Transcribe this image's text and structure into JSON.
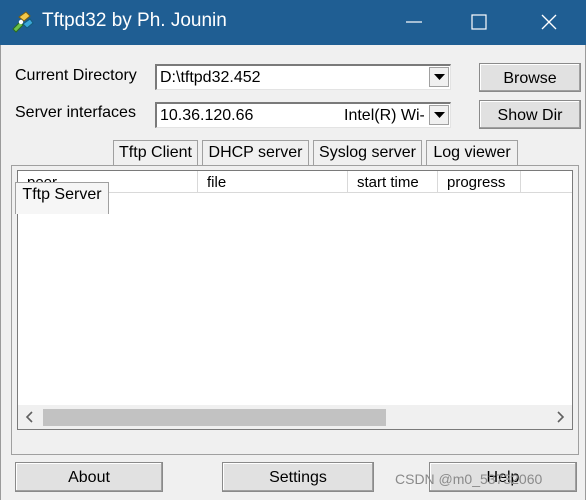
{
  "window": {
    "title": "Tftpd32 by Ph. Jounin",
    "icon": "tftpd32-app-icon",
    "title_bar_color": "#1f5e93"
  },
  "form": {
    "current_directory_label": "Current Directory",
    "current_directory_value": "D:\\tftpd32.452",
    "server_interfaces_label": "Server interfaces",
    "server_interface_ip": "10.36.120.66",
    "server_interface_adapter": "Intel(R) Wi-"
  },
  "buttons": {
    "browse": "Browse",
    "show_dir": "Show Dir",
    "about": "About",
    "settings": "Settings",
    "help": "Help"
  },
  "tabs": [
    {
      "label": "Tftp Server",
      "active": true
    },
    {
      "label": "Tftp Client",
      "active": false
    },
    {
      "label": "DHCP server",
      "active": false
    },
    {
      "label": "Syslog server",
      "active": false
    },
    {
      "label": "Log viewer",
      "active": false
    }
  ],
  "table": {
    "columns": [
      "peer",
      "file",
      "start time",
      "progress"
    ],
    "rows": []
  },
  "watermark": "CSDN @m0_53732060"
}
